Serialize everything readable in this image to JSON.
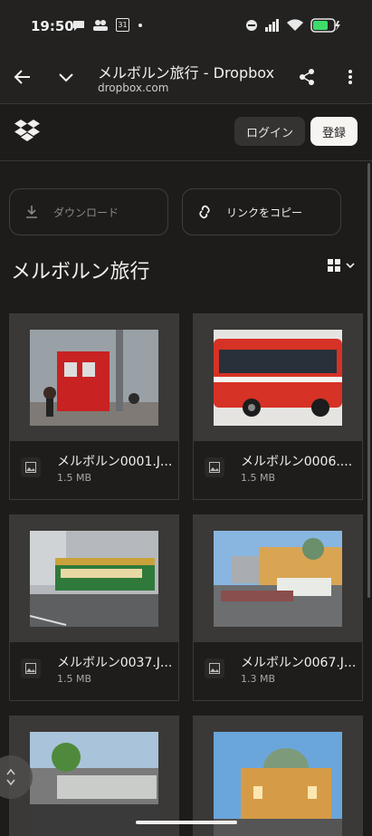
{
  "status_bar": {
    "time": "19:50",
    "calendar_day": "31"
  },
  "browser": {
    "page_title": "メルボルン旅行 - Dropbox",
    "url": "dropbox.com"
  },
  "header": {
    "login_label": "ログイン",
    "register_label": "登録"
  },
  "actions": {
    "download_label": "ダウンロード",
    "copy_link_label": "リンクをコピー"
  },
  "folder": {
    "title": "メルボルン旅行"
  },
  "files": [
    {
      "name": "メルボルン0001.J...",
      "size": "1.5 MB"
    },
    {
      "name": "メルボルン0006....",
      "size": "1.5 MB"
    },
    {
      "name": "メルボルン0037.J...",
      "size": "1.5 MB"
    },
    {
      "name": "メルボルン0067.J...",
      "size": "1.3 MB"
    }
  ],
  "colors": {
    "background": "#1e1c1b",
    "accent": "#f7f5f2"
  }
}
